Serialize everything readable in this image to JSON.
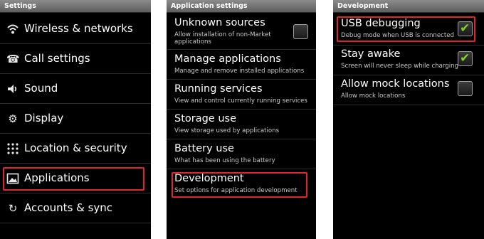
{
  "screen1": {
    "title": "Settings",
    "items": [
      {
        "label": "Wireless & networks",
        "icon": "wifi-icon",
        "glyph": "◢"
      },
      {
        "label": "Call settings",
        "icon": "phone-icon",
        "glyph": "☎"
      },
      {
        "label": "Sound",
        "icon": "speaker-icon",
        "glyph": "◀"
      },
      {
        "label": "Display",
        "icon": "display-gear-icon",
        "glyph": "⚙"
      },
      {
        "label": "Location & security",
        "icon": "location-grid-icon",
        "glyph": "∷"
      },
      {
        "label": "Applications",
        "icon": "applications-icon",
        "glyph": "▣"
      },
      {
        "label": "Accounts & sync",
        "icon": "sync-icon",
        "glyph": "↻"
      }
    ]
  },
  "screen2": {
    "title": "Application settings",
    "items": [
      {
        "title": "Unknown sources",
        "subtitle_line1": "Allow installation of non-Market",
        "subtitle_line2": "applications",
        "checked": false
      },
      {
        "title": "Manage applications",
        "subtitle_line1": "Manage and remove installed applications"
      },
      {
        "title": "Running services",
        "subtitle_line1": "View and control currently running services"
      },
      {
        "title": "Storage use",
        "subtitle_line1": "View storage used by applications"
      },
      {
        "title": "Battery use",
        "subtitle_line1": "What has been using the battery"
      },
      {
        "title": "Development",
        "subtitle_line1": "Set options for application development"
      }
    ]
  },
  "screen3": {
    "title": "Development",
    "items": [
      {
        "title": "USB debugging",
        "subtitle": "Debug mode when USB is connected",
        "checked": true
      },
      {
        "title": "Stay awake",
        "subtitle": "Screen will never sleep while charging",
        "checked": true
      },
      {
        "title": "Allow mock locations",
        "subtitle": "Allow mock locations",
        "checked": false
      }
    ]
  },
  "colors": {
    "highlight": "#e0262d",
    "checkmark": "#7ed321",
    "background": "#000000"
  },
  "checkmark_glyph": "✔"
}
